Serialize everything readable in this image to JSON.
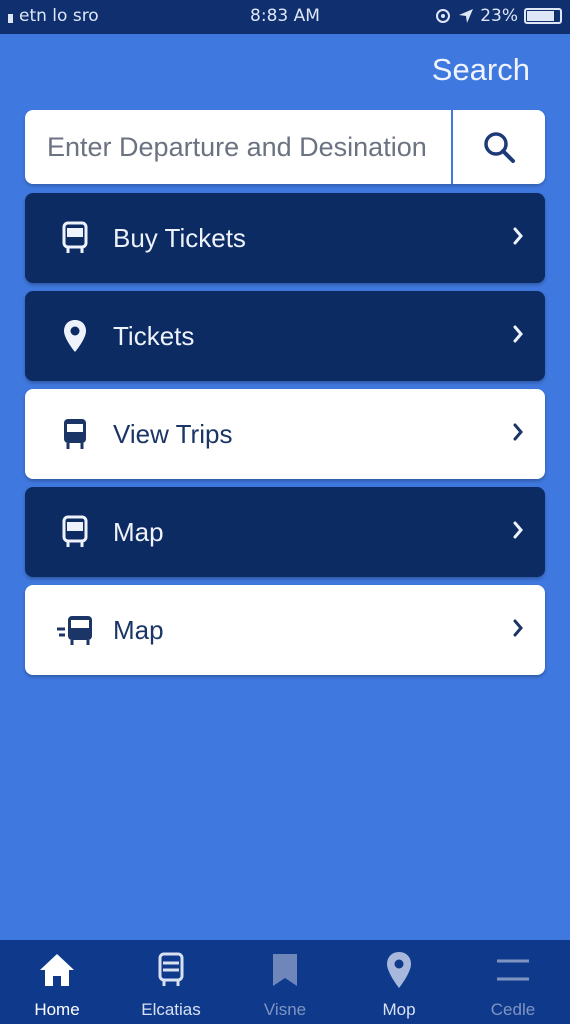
{
  "status_bar": {
    "carrier": "etn lo  sro",
    "time": "8:83 AM",
    "battery": "23%",
    "battery_level": 0.8
  },
  "header": {
    "search_label": "Search"
  },
  "search": {
    "placeholder": "Enter Departure and Desination",
    "button_icon": "search-icon"
  },
  "menu": {
    "items": [
      {
        "label": "Buy Tickets",
        "icon": "bus-icon",
        "style": "dark"
      },
      {
        "label": "Tickets",
        "icon": "location-pin-icon",
        "style": "dark"
      },
      {
        "label": "View Trips",
        "icon": "bus-icon",
        "style": "light"
      },
      {
        "label": "Map",
        "icon": "bus-icon",
        "style": "dark"
      },
      {
        "label": "Map",
        "icon": "moving-bus-icon",
        "style": "light"
      }
    ]
  },
  "tabbar": {
    "items": [
      {
        "label": "Home",
        "icon": "home-icon",
        "state": "active"
      },
      {
        "label": "Elcatias",
        "icon": "bus-icon",
        "state": "normal"
      },
      {
        "label": "Visne",
        "icon": "bookmark-icon",
        "state": "dim"
      },
      {
        "label": "Mop",
        "icon": "location-pin-icon",
        "state": "normal"
      },
      {
        "label": "Cedle",
        "icon": "menu-icon",
        "state": "dim"
      }
    ]
  },
  "colors": {
    "background": "#3f78de",
    "dark_card": "#0c2b63",
    "tabbar": "#0f3a8c",
    "status_bar": "#0f2f6e"
  }
}
